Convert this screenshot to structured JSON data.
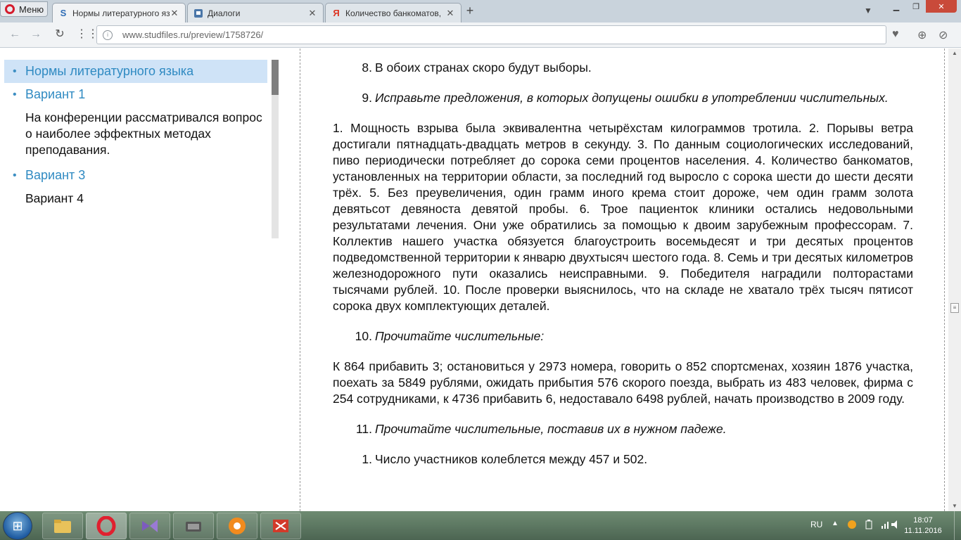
{
  "browser": {
    "menu_label": "Меню",
    "tabs": [
      {
        "title": "Нормы литературного язы",
        "favicon": "S",
        "active": true
      },
      {
        "title": "Диалоги",
        "favicon": "vk",
        "active": false
      },
      {
        "title": "Количество банкоматов,",
        "favicon": "Я",
        "active": false
      }
    ],
    "new_tab_symbol": "+",
    "url": "www.studfiles.ru/preview/1758726/"
  },
  "sidebar": {
    "items": [
      {
        "label": "Нормы литературного языка"
      },
      {
        "label": "Вариант 1"
      },
      {
        "text": "На конференции рассматривался вопрос о наиболее эффектных методах преподавания."
      },
      {
        "label": "Вариант 3"
      },
      {
        "text": "Вариант 4"
      }
    ]
  },
  "content": {
    "item8_num": "8.",
    "item8_text": "В обоих странах скоро будут выборы.",
    "item9_num": "9.",
    "item9_text": "Исправьте предложения, в которых допущены ошибки в употреблении числительных.",
    "para1": "1. Мощность взрыва была эквивалентна четырёхстам килограммов тротила. 2. Порывы ветра достигали пятнадцать-двадцать метров в секунду. 3. По данным социологических исследований, пиво периодически потребляет до сорока семи процентов населения. 4. Количество банкоматов, установленных на территории области, за последний год выросло с сорока шести до шести десяти трёх. 5. Без преувеличения, один грамм иного крема стоит дороже, чем один грамм золота девятьсот девяноста девятой пробы. 6. Трое пациенток клиники остались недовольными результатами лечения. Они уже обратились за помощью к двоим зарубежным профессорам. 7. Коллектив нашего участка обязуется благоустроить восемьдесят и три десятых процентов подведомственной территории к январю двухтысяч шестого года. 8. Семь и три десятых километров железнодорожного пути оказались неисправными. 9. Победителя наградили полторастами тысячами рублей. 10. После проверки выяснилось, что на складе не хватало трёх тысяч пятисот сорока двух комплектующих деталей.",
    "item10_num": "10.",
    "item10_text": "Прочитайте числительные:",
    "para2": "К 864 прибавить 3; остановиться у 2973 номера, говорить о 852 спортсменах, хозяин 1876 участка, поехать за 5849 рублями, ожидать прибытия 576 скорого поезда, выбрать из 483 человек, фирма с 254 сотрудниками, к 4736 прибавить 6, недоставало 6498 рублей, начать производство в 2009 году.",
    "item11_num": "11.",
    "item11_text": "Прочитайте числительные, поставив их в нужном падеже.",
    "sub1_num": "1.",
    "sub1_text": "Число участников колеблется между 457 и 502."
  },
  "taskbar": {
    "language": "RU",
    "time": "18:07",
    "date": "11.11.2016"
  },
  "colors": {
    "link": "#2f8ac2",
    "active_sidebar_bg": "#cfe3f7",
    "opera_red": "#d51b2c"
  }
}
